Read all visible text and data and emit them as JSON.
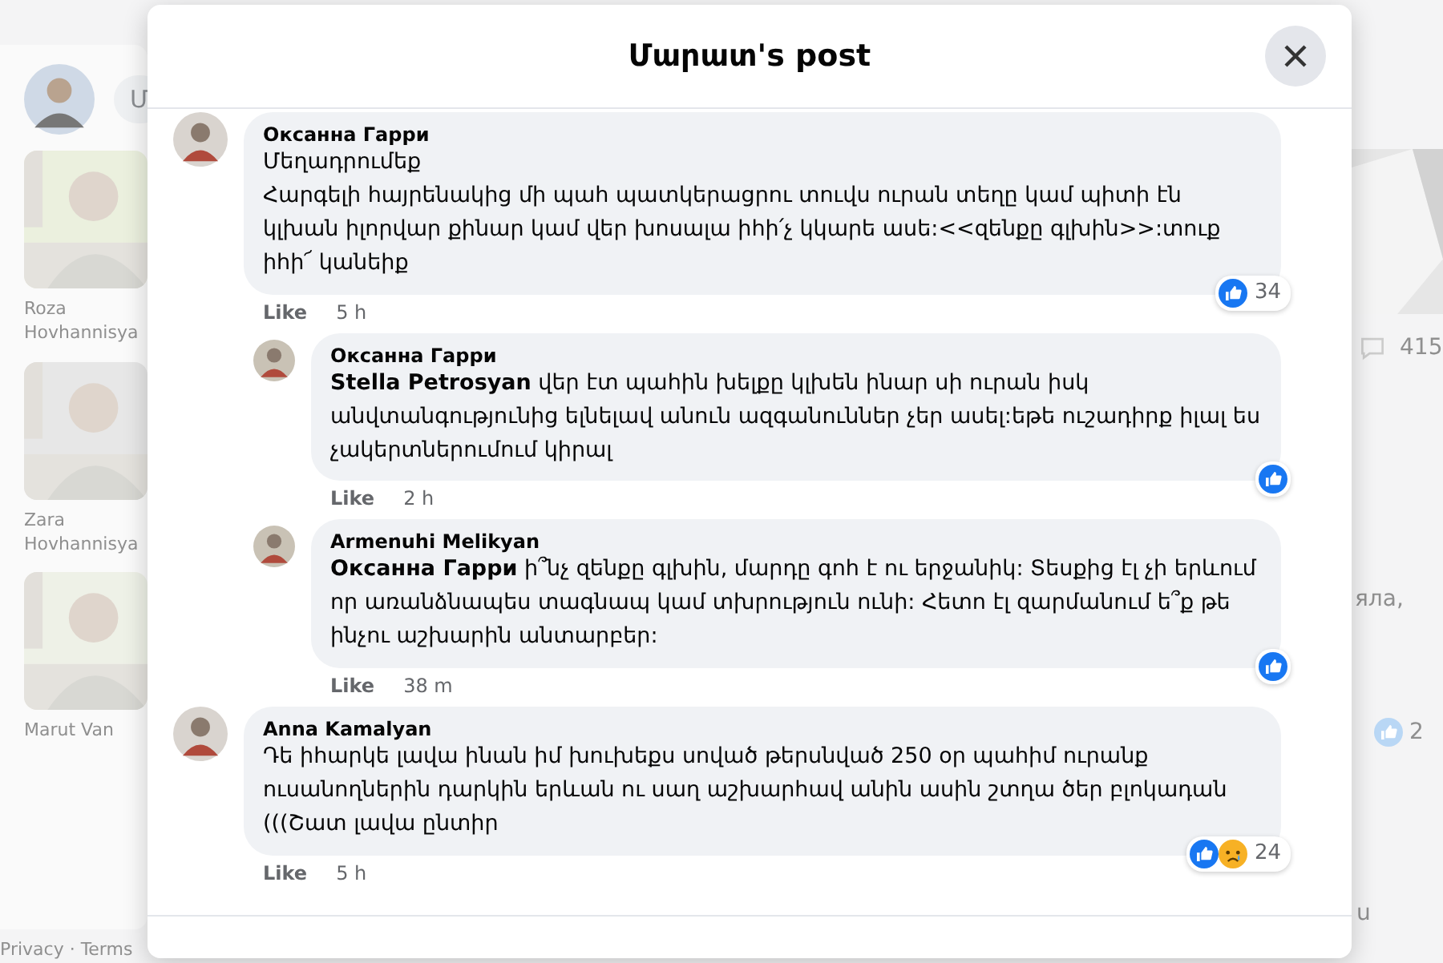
{
  "background": {
    "composer_placeholder": "Մ",
    "people": [
      {
        "name": "Roza Hovhannisya"
      },
      {
        "name": "Zara Hovhannisya"
      },
      {
        "name": "Marut Van"
      }
    ],
    "footer": "Privacy · Terms",
    "comment_count": "415",
    "snippet": "яла,",
    "reaction_count": "2",
    "edge_text": "u"
  },
  "dialog": {
    "title": "Մարատ's post",
    "comments": [
      {
        "author": "Оксанна Гарри",
        "text": "Մեղադրումեք\nՀարգելի հայրենակից մի պահ պատկերացրու տուվս ուրան տեղը կամ պիտի էն կլխան իլորվար քինար կամ վեր խոսալա իհի՛չ կկարե ասե:<<զենքը գլխին>>:տուք իհի՜ կանեիք",
        "like": "Like",
        "time": "5 h",
        "reply": false,
        "reactions": [
          {
            "kind": "like"
          }
        ],
        "count": "34"
      },
      {
        "author": "Оксанна Гарри",
        "mention": "Stella Petrosyan",
        "text": "վեր էտ պահին խելքը կլխեն ինար սի ուրան իսկ անվտանգությունից ելնելավ անուն ազգանուններ չեր ասել:եթե ուշադիրք իլալ ես չակերտներումում կիրալ",
        "like": "Like",
        "time": "2 h",
        "reply": true,
        "reactions": [
          {
            "kind": "like"
          }
        ]
      },
      {
        "author": "Armenuhi Melikyan",
        "mention": "Оксанна Гарри",
        "text": "ի՞նչ զենքը գլխին, մարդը գոհ է ու երջանիկ: Տեսքից էլ չի երևում որ առանձնապես տագնապ կամ տխրություն ունի: Հետո էլ զարմանում ե՞ք թե ինչու աշխարին անտարբեր:",
        "like": "Like",
        "time": "38 m",
        "reply": true,
        "reactions": [
          {
            "kind": "like"
          }
        ]
      },
      {
        "author": "Anna Kamalyan",
        "text": "Դե իհարկե լավա ինան իմ խուխեքս սոված թերսնված 250 օր պահիմ ուրանք ուսանողներին դարկին երևան ու սաղ աշխարհավ անին ասին շտղա ծեր բլոկադան (((Շատ լավա ընտիր",
        "like": "Like",
        "time": "5 h",
        "reply": false,
        "reactions": [
          {
            "kind": "like"
          },
          {
            "kind": "sad"
          }
        ],
        "count": "24"
      }
    ]
  }
}
